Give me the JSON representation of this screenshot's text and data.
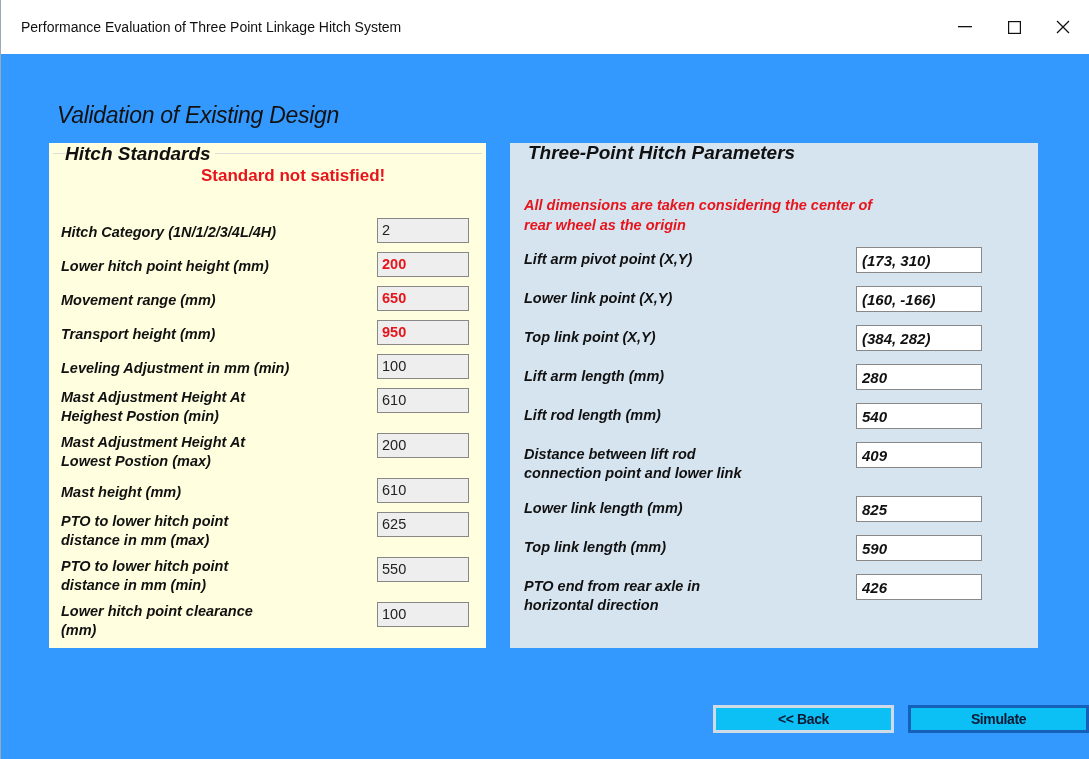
{
  "window": {
    "title": "Performance Evaluation of Three Point Linkage Hitch System"
  },
  "heading": "Validation of Existing Design",
  "hitch_standards": {
    "title": "Hitch Standards",
    "status": "Standard not satisfied!",
    "fields": [
      {
        "label": "Hitch Category (1N/1/2/3/4L/4H)",
        "value": "2",
        "flagged": false
      },
      {
        "label": "Lower hitch point height (mm)",
        "value": "200",
        "flagged": true
      },
      {
        "label": "Movement range (mm)",
        "value": "650",
        "flagged": true
      },
      {
        "label": "Transport height (mm)",
        "value": "950",
        "flagged": true
      },
      {
        "label": "Leveling Adjustment in mm (min)",
        "value": "100",
        "flagged": false
      },
      {
        "label": "Mast Adjustment Height At\nHeighest Postion (min)",
        "value": "610",
        "flagged": false
      },
      {
        "label": "Mast Adjustment Height At\nLowest Postion (max)",
        "value": "200",
        "flagged": false
      },
      {
        "label": "Mast height (mm)",
        "value": "610",
        "flagged": false
      },
      {
        "label": "PTO to lower hitch point\ndistance in mm (max)",
        "value": "625",
        "flagged": false
      },
      {
        "label": "PTO to lower hitch point\ndistance in mm (min)",
        "value": "550",
        "flagged": false
      },
      {
        "label": "Lower hitch point clearance\n(mm)",
        "value": "100",
        "flagged": false
      }
    ]
  },
  "hitch_parameters": {
    "title": "Three-Point Hitch Parameters",
    "note": "All dimensions are taken considering the center of\nrear wheel as the origin",
    "fields": [
      {
        "label": "Lift arm pivot point (X,Y)",
        "value": "(173, 310)"
      },
      {
        "label": "Lower link point (X,Y)",
        "value": "(160, -166)"
      },
      {
        "label": "Top link point (X,Y)",
        "value": "(384, 282)"
      },
      {
        "label": "Lift arm length (mm)",
        "value": "280"
      },
      {
        "label": "Lift rod length (mm)",
        "value": "540"
      },
      {
        "label": "Distance between lift rod\nconnection point and lower link",
        "value": "409"
      },
      {
        "label": "Lower link length (mm)",
        "value": "825"
      },
      {
        "label": "Top link length (mm)",
        "value": "590"
      },
      {
        "label": "PTO end from rear axle in\nhorizontal direction",
        "value": "426"
      }
    ]
  },
  "buttons": [
    {
      "label": "<< Back",
      "focused": false
    },
    {
      "label": "Simulate",
      "focused": true
    }
  ]
}
